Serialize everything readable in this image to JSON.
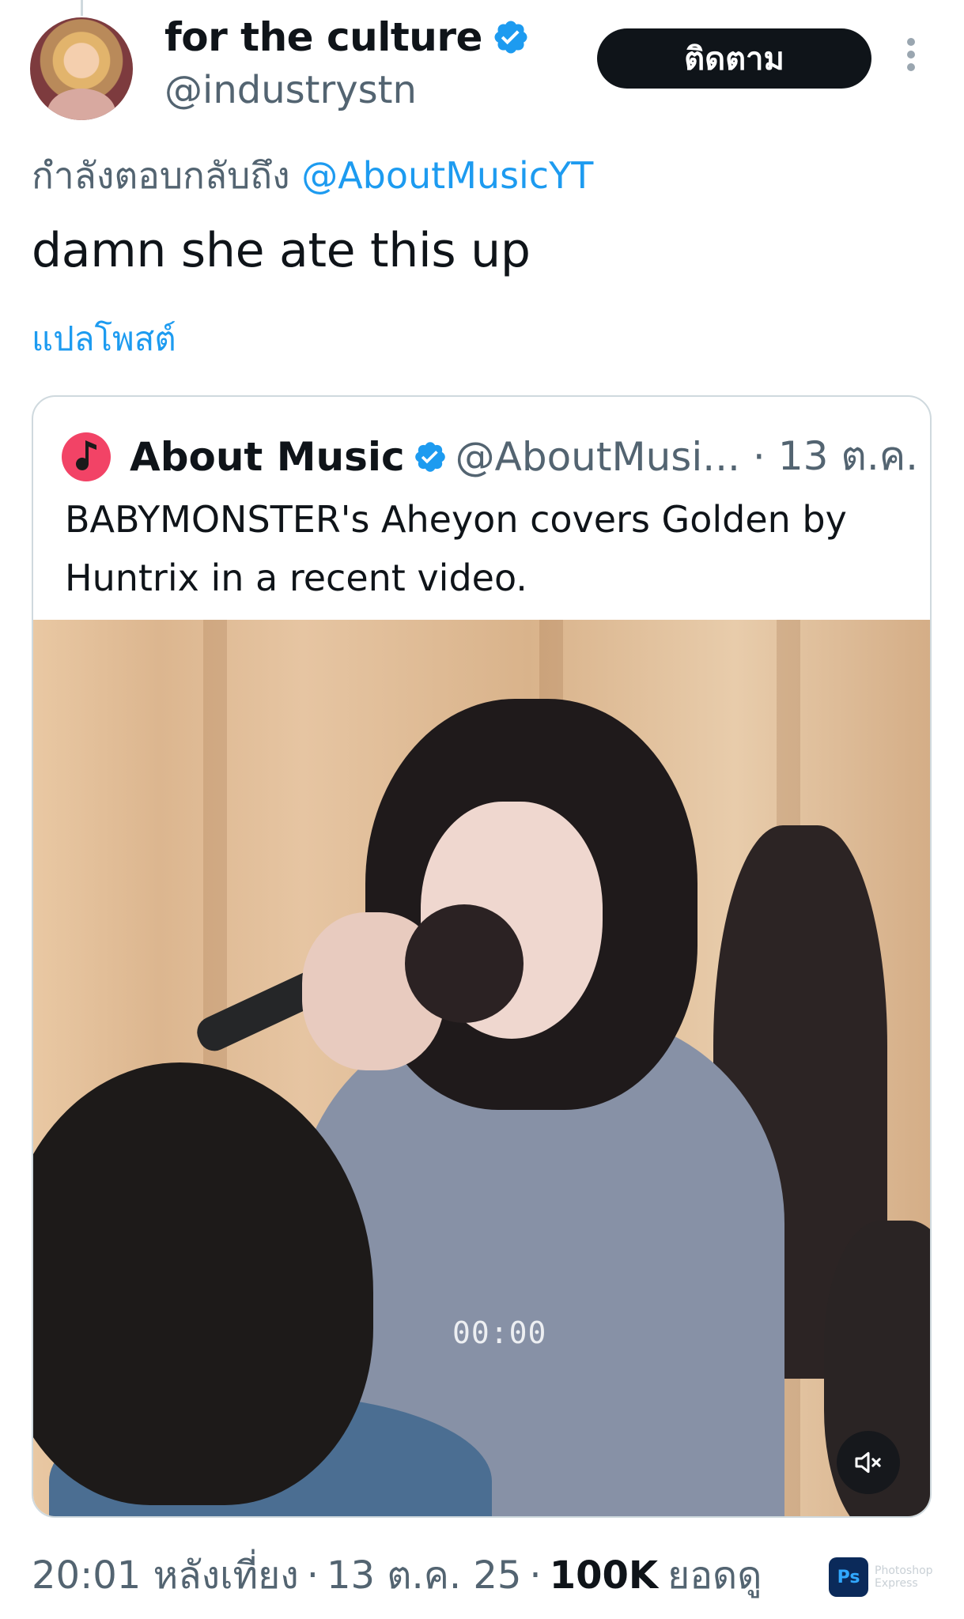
{
  "post": {
    "display_name": "for the culture",
    "handle": "@industrystn",
    "follow_label": "ติดตาม",
    "reply_prefix": "กำลังตอบกลับถึง",
    "reply_mention": "@AboutMusicYT",
    "text": "damn she ate this up",
    "translate_label": "แปลโพสต์"
  },
  "quote": {
    "display_name": "About Music",
    "handle": "@AboutMusi...",
    "separator": "·",
    "date": "13 ต.ค.",
    "text": "BABYMONSTER's Aheyon covers Golden by Huntrix in a recent video.",
    "video": {
      "timecode": "00:00",
      "mute_icon": "speaker-muted-icon"
    }
  },
  "footer": {
    "time": "20:01 หลังเที่ยง",
    "separator": "·",
    "date": "13 ต.ค. 25",
    "views": "100K",
    "views_label": "ยอดดู"
  },
  "watermark": {
    "icon_text": "Ps",
    "label": "Photoshop Express"
  },
  "colors": {
    "accent": "#1d9bf0",
    "text": "#0f1419",
    "secondary": "#536471",
    "follow_button": "#0f1419",
    "quote_avatar": "#f24366"
  }
}
